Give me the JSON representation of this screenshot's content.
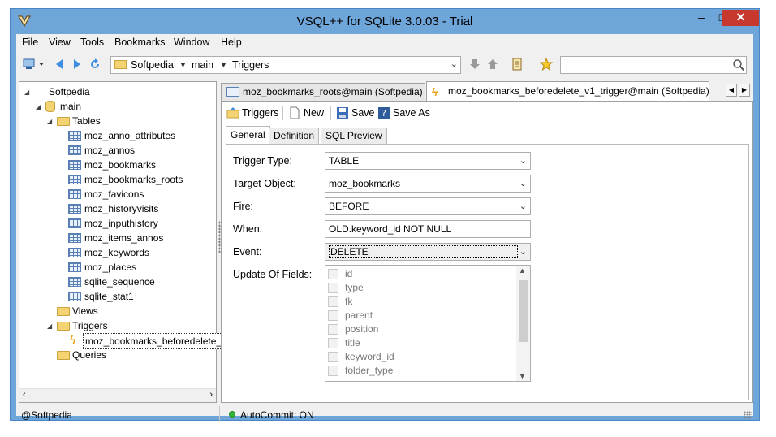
{
  "window": {
    "title": "VSQL++ for SQLite 3.0.03 - Trial",
    "minimize_label": "–",
    "maximize_label": "□",
    "close_label": "✕"
  },
  "menu": [
    "File",
    "View",
    "Tools",
    "Bookmarks",
    "Window",
    "Help"
  ],
  "toolbar": {
    "path": [
      "Softpedia",
      "main",
      "Triggers"
    ],
    "search_value": ""
  },
  "tree": {
    "root": "Softpedia",
    "db": "main",
    "tables_label": "Tables",
    "tables": [
      "moz_anno_attributes",
      "moz_annos",
      "moz_bookmarks",
      "moz_bookmarks_roots",
      "moz_favicons",
      "moz_historyvisits",
      "moz_inputhistory",
      "moz_items_annos",
      "moz_keywords",
      "moz_places",
      "sqlite_sequence",
      "sqlite_stat1"
    ],
    "views_label": "Views",
    "triggers_label": "Triggers",
    "trigger_item": "moz_bookmarks_beforedelete_",
    "queries_label": "Queries"
  },
  "tabs": [
    "moz_bookmarks_roots@main (Softpedia)",
    "moz_bookmarks_beforedelete_v1_trigger@main (Softpedia)"
  ],
  "actions": {
    "triggers": "Triggers",
    "new": "New",
    "save": "Save",
    "save_as": "Save As"
  },
  "subtabs": [
    "General",
    "Definition",
    "SQL Preview"
  ],
  "form": {
    "trigger_type_label": "Trigger Type:",
    "trigger_type_value": "TABLE",
    "target_object_label": "Target Object:",
    "target_object_value": "moz_bookmarks",
    "fire_label": "Fire:",
    "fire_value": "BEFORE",
    "when_label": "When:",
    "when_value": "OLD.keyword_id NOT NULL",
    "event_label": "Event:",
    "event_value": "DELETE",
    "update_fields_label": "Update Of Fields:",
    "fields": [
      "id",
      "type",
      "fk",
      "parent",
      "position",
      "title",
      "keyword_id",
      "folder_type"
    ]
  },
  "status": {
    "connection": "@Softpedia",
    "autocommit": "AutoCommit: ON"
  },
  "colors": {
    "window_frame": "#6fa6da",
    "close_button": "#c7392f",
    "status_ok": "#35b535"
  }
}
